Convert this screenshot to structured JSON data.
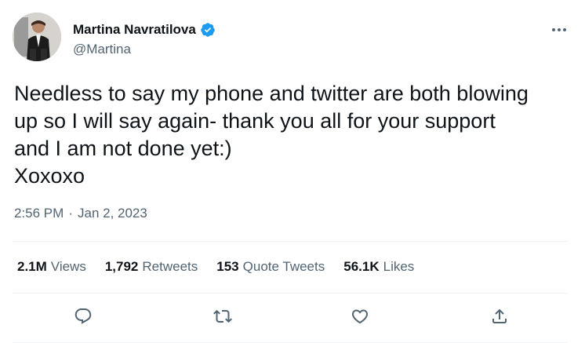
{
  "author": {
    "display_name": "Martina Navratilova",
    "handle": "@Martina",
    "verified": true
  },
  "tweet": {
    "text_lines": [
      "Needless to say my phone and twitter are both blowing",
      "up so I will say again- thank you all for your support",
      "and I am not done yet:)",
      "Xoxoxo"
    ],
    "time": "2:56 PM",
    "separator": "·",
    "date": "Jan 2, 2023"
  },
  "stats": [
    {
      "count": "2.1M",
      "label": "Views"
    },
    {
      "count": "1,792",
      "label": "Retweets"
    },
    {
      "count": "153",
      "label": "Quote Tweets"
    },
    {
      "count": "56.1K",
      "label": "Likes"
    }
  ],
  "actions": [
    "reply-icon",
    "retweet-icon",
    "like-icon",
    "share-icon"
  ],
  "colors": {
    "text_primary": "#0f1419",
    "text_secondary": "#536471",
    "verified_blue": "#1d9bf0",
    "divider": "#eff3f4"
  }
}
